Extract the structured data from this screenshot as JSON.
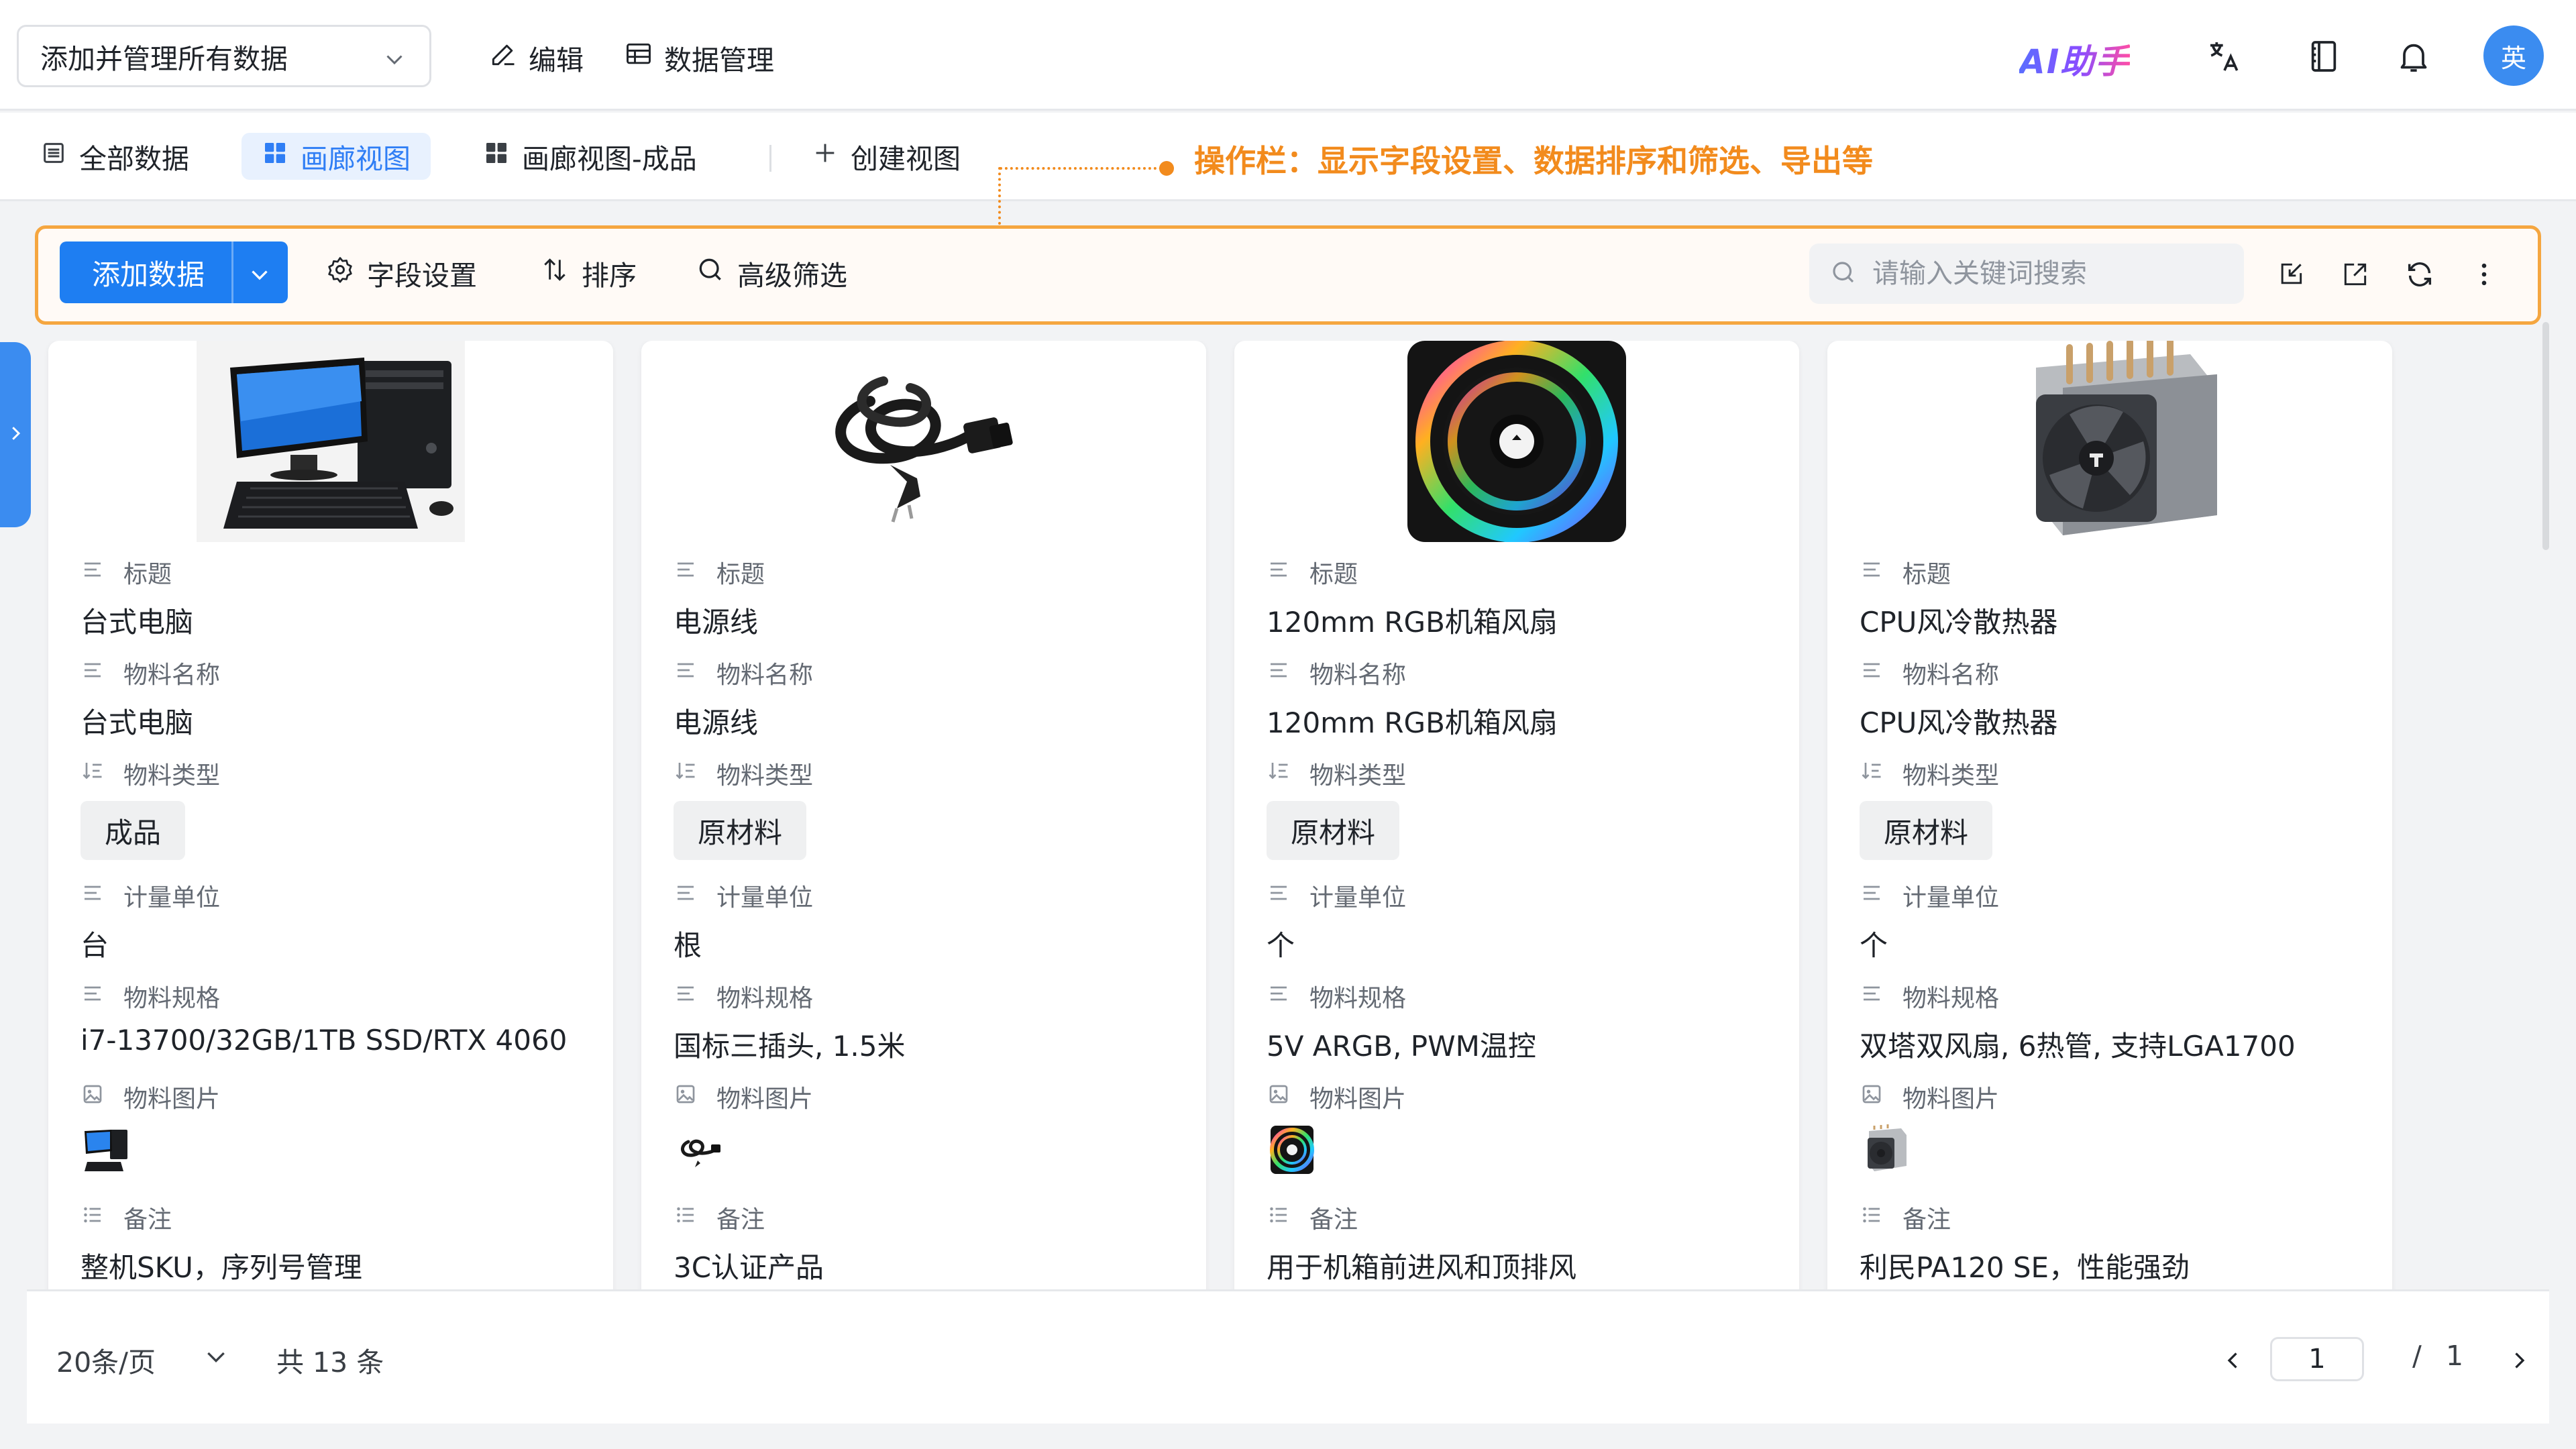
{
  "header": {
    "app_select": "添加并管理所有数据",
    "edit_label": "编辑",
    "data_mgmt_label": "数据管理",
    "ai_label": "AI助手",
    "avatar_text": "英"
  },
  "view_tabs": {
    "all_data": "全部数据",
    "gallery": "画廊视图",
    "gallery_finished": "画廊视图-成品",
    "create_view": "创建视图"
  },
  "annotation": "操作栏：显示字段设置、数据排序和筛选、导出等",
  "toolbar": {
    "add_data": "添加数据",
    "field_settings": "字段设置",
    "sort": "排序",
    "advanced_filter": "高级筛选",
    "search_placeholder": "请输入关键词搜索"
  },
  "field_labels": {
    "title": "标题",
    "material_name": "物料名称",
    "material_type": "物料类型",
    "unit": "计量单位",
    "spec": "物料规格",
    "image": "物料图片",
    "remark": "备注"
  },
  "cards": [
    {
      "title": "台式电脑",
      "material_name": "台式电脑",
      "material_type": "成品",
      "unit": "台",
      "spec": "i7-13700/32GB/1TB SSD/RTX 4060",
      "image": "desktop-computer",
      "remark": "整机SKU，序列号管理"
    },
    {
      "title": "电源线",
      "material_name": "电源线",
      "material_type": "原材料",
      "unit": "根",
      "spec": "国标三插头, 1.5米",
      "image": "power-cable",
      "remark": "3C认证产品"
    },
    {
      "title": "120mm RGB机箱风扇",
      "material_name": "120mm RGB机箱风扇",
      "material_type": "原材料",
      "unit": "个",
      "spec": "5V ARGB, PWM温控",
      "image": "rgb-case-fan",
      "remark": "用于机箱前进风和顶排风"
    },
    {
      "title": "CPU风冷散热器",
      "material_name": "CPU风冷散热器",
      "material_type": "原材料",
      "unit": "个",
      "spec": "双塔双风扇, 6热管, 支持LGA1700",
      "image": "cpu-air-cooler",
      "remark": "利民PA120 SE，性能强劲"
    }
  ],
  "footer": {
    "page_size": "20条/页",
    "total": "共 13 条",
    "current_page": "1",
    "separator": "/",
    "total_pages": "1"
  },
  "colors": {
    "accent": "#1e7ef2",
    "annotation": "#f28b1d",
    "active_tab_bg": "#e8f1fe"
  }
}
